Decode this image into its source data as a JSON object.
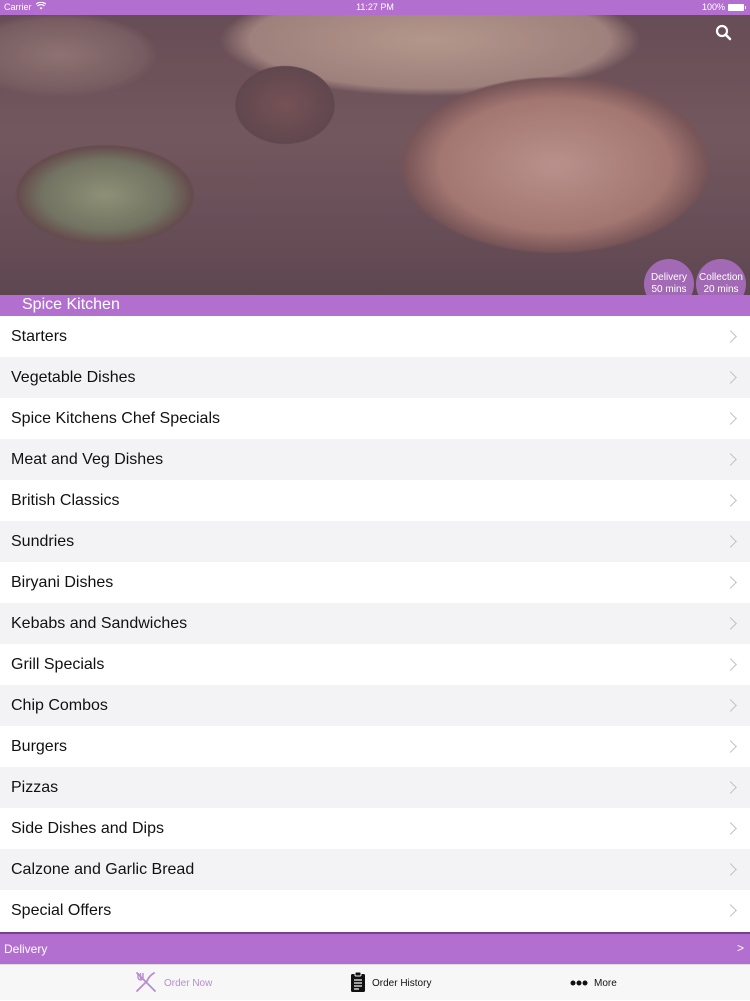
{
  "status": {
    "carrier": "Carrier",
    "time": "11:27 PM",
    "battery": "100%"
  },
  "hero": {
    "restaurant_name": "Spice Kitchen",
    "delivery": {
      "label": "Delivery",
      "time": "50 mins"
    },
    "collection": {
      "label": "Collection",
      "time": "20 mins"
    }
  },
  "menu": {
    "items": [
      "Starters",
      "Vegetable Dishes",
      "Spice Kitchens Chef Specials",
      "Meat and Veg Dishes",
      "British Classics",
      "Sundries",
      "Biryani Dishes",
      "Kebabs and Sandwiches",
      "Grill Specials",
      "Chip Combos",
      "Burgers",
      "Pizzas",
      "Side Dishes and Dips",
      "Calzone and Garlic Bread",
      "Special Offers"
    ]
  },
  "delivery_bar": {
    "label": "Delivery",
    "arrow": ">"
  },
  "tabs": {
    "order_now": "Order Now",
    "order_history": "Order History",
    "more": "More"
  },
  "colors": {
    "accent": "#b36fcf",
    "active_tab": "#b98bd1"
  },
  "icons": {
    "search": "search-icon",
    "wifi": "wifi-icon",
    "battery": "battery-icon",
    "fork_knife": "fork-knife-icon",
    "clipboard": "clipboard-icon",
    "more": "more-dots-icon"
  }
}
